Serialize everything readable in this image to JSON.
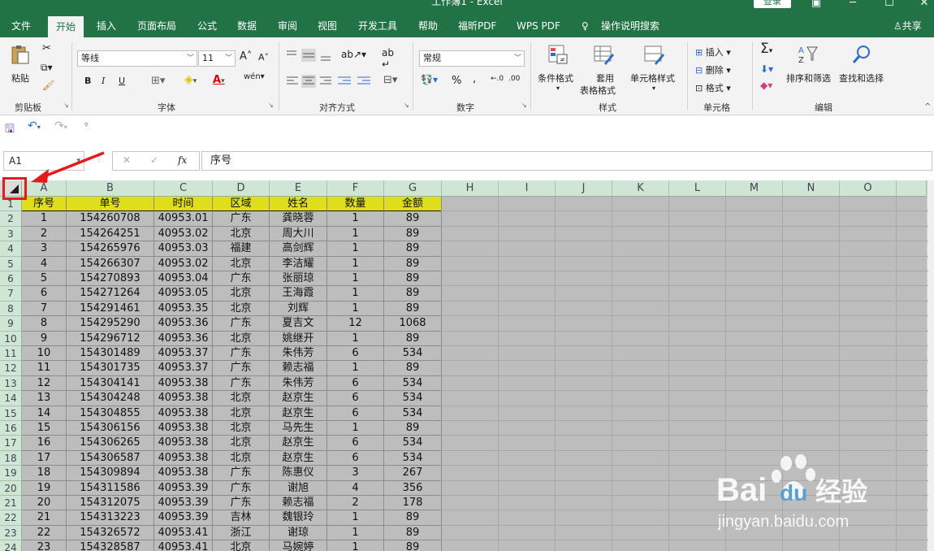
{
  "window": {
    "title": "工作簿1 - Excel",
    "login": "登录"
  },
  "menu": {
    "tabs": [
      "文件",
      "开始",
      "插入",
      "页面布局",
      "公式",
      "数据",
      "审阅",
      "视图",
      "开发工具",
      "帮助",
      "福昕PDF",
      "WPS PDF",
      "操作说明搜索"
    ],
    "active": "开始",
    "share": "共享"
  },
  "ribbon": {
    "clipboard": {
      "paste": "粘贴",
      "label": "剪贴板"
    },
    "font": {
      "name": "等线",
      "size": "11",
      "bold": "B",
      "italic": "I",
      "underline": "U",
      "label": "字体",
      "grow": "A",
      "shrink": "A",
      "wen": "wén"
    },
    "align": {
      "label": "对齐方式"
    },
    "number": {
      "format": "常规",
      "percent": "%",
      "comma": ",",
      "label": "数字"
    },
    "styles": {
      "conditional": "条件格式",
      "table1": "套用",
      "table2": "表格格式",
      "cell": "单元格样式",
      "label": "样式"
    },
    "cells": {
      "insert": "插入",
      "delete": "删除",
      "format": "格式",
      "label": "单元格"
    },
    "edit": {
      "sort": "排序和筛选",
      "find": "查找和选择",
      "label": "编辑"
    }
  },
  "formula_bar": {
    "name_box": "A1",
    "fx": "fx",
    "value": "序号"
  },
  "sheet": {
    "columns": [
      "A",
      "B",
      "C",
      "D",
      "E",
      "F",
      "G",
      "H",
      "I",
      "J",
      "K",
      "L",
      "M",
      "N",
      "O"
    ],
    "rows": [
      "1",
      "2",
      "3",
      "4",
      "5",
      "6",
      "7",
      "8",
      "9",
      "10",
      "11",
      "12",
      "13",
      "14",
      "15",
      "16",
      "17",
      "18",
      "19",
      "20",
      "21",
      "22",
      "23",
      "24"
    ],
    "header": [
      "序号",
      "单号",
      "时间",
      "区域",
      "姓名",
      "数量",
      "金额"
    ],
    "data": [
      [
        "1",
        "154260708",
        "40953.01",
        "广东",
        "龚晓蓉",
        "1",
        "89"
      ],
      [
        "2",
        "154264251",
        "40953.02",
        "北京",
        "周大川",
        "1",
        "89"
      ],
      [
        "3",
        "154265976",
        "40953.03",
        "福建",
        "高剑辉",
        "1",
        "89"
      ],
      [
        "4",
        "154266307",
        "40953.02",
        "北京",
        "李洁耀",
        "1",
        "89"
      ],
      [
        "5",
        "154270893",
        "40953.04",
        "广东",
        "张丽琼",
        "1",
        "89"
      ],
      [
        "6",
        "154271264",
        "40953.05",
        "北京",
        "王海霞",
        "1",
        "89"
      ],
      [
        "7",
        "154291461",
        "40953.35",
        "北京",
        "刘辉",
        "1",
        "89"
      ],
      [
        "8",
        "154295290",
        "40953.36",
        "广东",
        "夏吉文",
        "12",
        "1068"
      ],
      [
        "9",
        "154296712",
        "40953.36",
        "北京",
        "姚继开",
        "1",
        "89"
      ],
      [
        "10",
        "154301489",
        "40953.37",
        "广东",
        "朱伟芳",
        "6",
        "534"
      ],
      [
        "11",
        "154301735",
        "40953.37",
        "广东",
        "赖志福",
        "1",
        "89"
      ],
      [
        "12",
        "154304141",
        "40953.38",
        "广东",
        "朱伟芳",
        "6",
        "534"
      ],
      [
        "13",
        "154304248",
        "40953.38",
        "北京",
        "赵京生",
        "6",
        "534"
      ],
      [
        "14",
        "154304855",
        "40953.38",
        "北京",
        "赵京生",
        "6",
        "534"
      ],
      [
        "15",
        "154306156",
        "40953.38",
        "北京",
        "马先生",
        "1",
        "89"
      ],
      [
        "16",
        "154306265",
        "40953.38",
        "北京",
        "赵京生",
        "6",
        "534"
      ],
      [
        "17",
        "154306587",
        "40953.38",
        "北京",
        "赵京生",
        "6",
        "534"
      ],
      [
        "18",
        "154309894",
        "40953.38",
        "广东",
        "陈惠仪",
        "3",
        "267"
      ],
      [
        "19",
        "154311586",
        "40953.39",
        "广东",
        "谢旭",
        "4",
        "356"
      ],
      [
        "20",
        "154312075",
        "40953.39",
        "广东",
        "赖志福",
        "2",
        "178"
      ],
      [
        "21",
        "154313223",
        "40953.39",
        "吉林",
        "魏银玲",
        "1",
        "89"
      ],
      [
        "22",
        "154326572",
        "40953.41",
        "浙江",
        "谢琼",
        "1",
        "89"
      ],
      [
        "23",
        "154328587",
        "40953.41",
        "北京",
        "马婉婷",
        "1",
        "89"
      ]
    ]
  },
  "watermark": {
    "brand": "Bai",
    "brand2": "du",
    "cn": "经验",
    "url": "jingyan.baidu.com"
  },
  "colors": {
    "excel_green": "#217346",
    "header_fill": "#dede1c",
    "selection_gray": "#bdbdbd",
    "annotation_red": "#e41b1b"
  }
}
